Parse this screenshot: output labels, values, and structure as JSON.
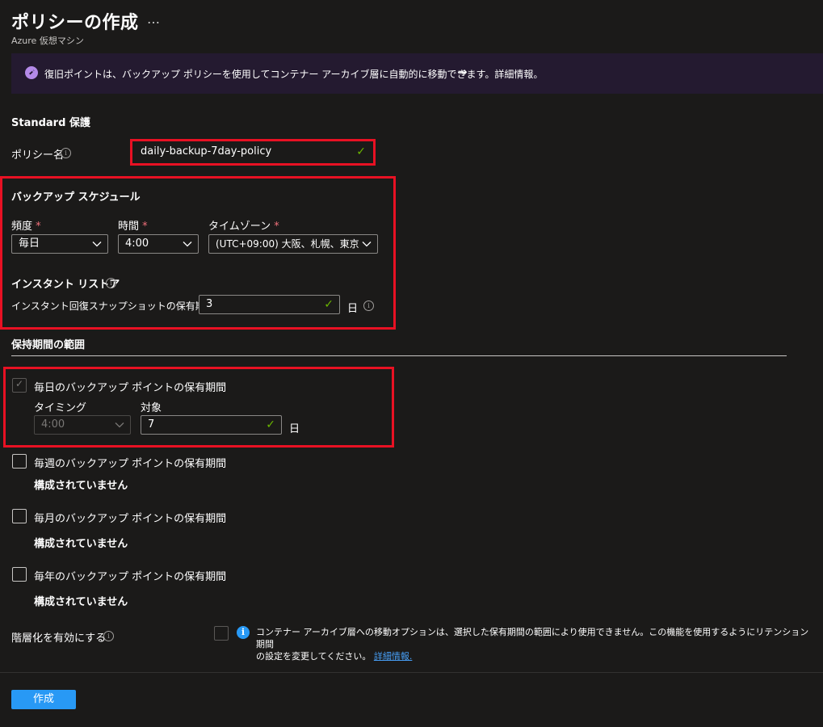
{
  "header": {
    "title": "ポリシーの作成",
    "more": "…",
    "subtitle": "Azure 仮想マシン"
  },
  "banner": {
    "text": "復旧ポイントは、バックアップ ポリシーを使用してコンテナー アーカイブ層に自動的に移動できます。詳細情報。",
    "arrow": "→"
  },
  "standard_heading": "Standard 保護",
  "policy_name": {
    "label": "ポリシー名",
    "value": "daily-backup-7day-policy"
  },
  "schedule": {
    "heading": "バックアップ スケジュール",
    "frequency_label": "頻度",
    "frequency_value": "毎日",
    "time_label": "時間",
    "time_value": "4:00",
    "timezone_label": "タイムゾーン",
    "timezone_value": "(UTC+09:00) 大阪、札幌、東京",
    "required_mark": "*"
  },
  "instant_restore": {
    "heading": "インスタント リストア",
    "retention_label": "インスタント回復スナップショットの保有期間",
    "retention_value": "3",
    "unit": "日"
  },
  "retention_range": {
    "heading": "保持期間の範囲",
    "daily": {
      "label": "毎日のバックアップ ポイントの保有期間",
      "checked": true,
      "timing_label": "タイミング",
      "timing_value": "4:00",
      "target_label": "対象",
      "target_value": "7",
      "unit": "日"
    },
    "weekly": {
      "label": "毎週のバックアップ ポイントの保有期間",
      "status": "構成されていません"
    },
    "monthly": {
      "label": "毎月のバックアップ ポイントの保有期間",
      "status": "構成されていません"
    },
    "yearly": {
      "label": "毎年のバックアップ ポイントの保有期間",
      "status": "構成されていません"
    }
  },
  "tiering": {
    "label": "階層化を有効にする",
    "note_line1": "コンテナー アーカイブ層への移動オプションは、選択した保有期間の範囲により使用できません。この機能を使用するようにリテンション期間",
    "note_line2": "の設定を変更してください。",
    "link": "詳細情報."
  },
  "create_button": "作成",
  "colors": {
    "background": "#1b1a19",
    "accent": "#2899f5",
    "highlight": "#e81123",
    "valid": "#6bb700"
  }
}
